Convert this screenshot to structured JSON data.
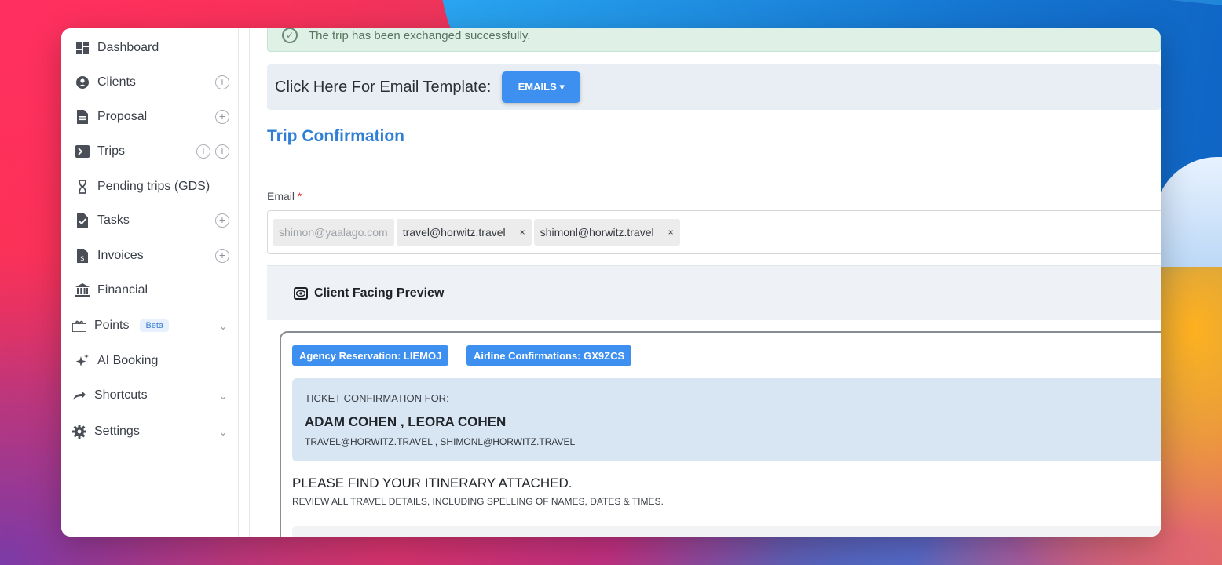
{
  "sidebar": {
    "items": [
      {
        "label": "Dashboard",
        "icon": "dashboard-icon"
      },
      {
        "label": "Clients",
        "icon": "clients-icon"
      },
      {
        "label": "Proposal",
        "icon": "document-icon"
      },
      {
        "label": "Trips",
        "icon": "terminal-icon"
      },
      {
        "label": "Pending trips (GDS)",
        "icon": "hourglass-icon"
      },
      {
        "label": "Tasks",
        "icon": "task-icon"
      },
      {
        "label": "Invoices",
        "icon": "invoice-icon"
      },
      {
        "label": "Financial",
        "icon": "bank-icon"
      },
      {
        "label": "Points",
        "icon": "points-icon",
        "badge": "Beta"
      },
      {
        "label": "AI Booking",
        "icon": "sparkle-icon"
      },
      {
        "label": "Shortcuts",
        "icon": "share-icon"
      },
      {
        "label": "Settings",
        "icon": "gear-icon"
      }
    ]
  },
  "alert": {
    "text": "The trip has been exchanged successfully."
  },
  "email_template": {
    "text": "Click Here For Email Template:",
    "button_label": "EMAILS ▾"
  },
  "trip": {
    "title": "Trip Confirmation"
  },
  "email_field": {
    "label": "Email",
    "required_mark": "*",
    "chips": [
      {
        "text": "shimon@yaalago.com",
        "removable": false
      },
      {
        "text": "travel@horwitz.travel",
        "removable": true
      },
      {
        "text": "shimonl@horwitz.travel",
        "removable": true
      }
    ],
    "remove_glyph": "×"
  },
  "preview": {
    "title": "Client Facing Preview",
    "agency_badge": "Agency Reservation: LIEMOJ",
    "airline_badge": "Airline Confirmations: GX9ZCS",
    "ticket_label": "TICKET CONFIRMATION FOR:",
    "names": "ADAM COHEN , LEORA COHEN",
    "emails": "TRAVEL@HORWITZ.TRAVEL , SHIMONL@HORWITZ.TRAVEL",
    "find_text": "PLEASE FIND YOUR ITINERARY ATTACHED.",
    "review_text": "REVIEW ALL TRAVEL DETAILS, INCLUDING SPELLING OF NAMES, DATES & TIMES."
  },
  "colors": {
    "accent": "#3d8ff0",
    "title": "#2f7fd6",
    "success_bg": "#dff1e6"
  }
}
